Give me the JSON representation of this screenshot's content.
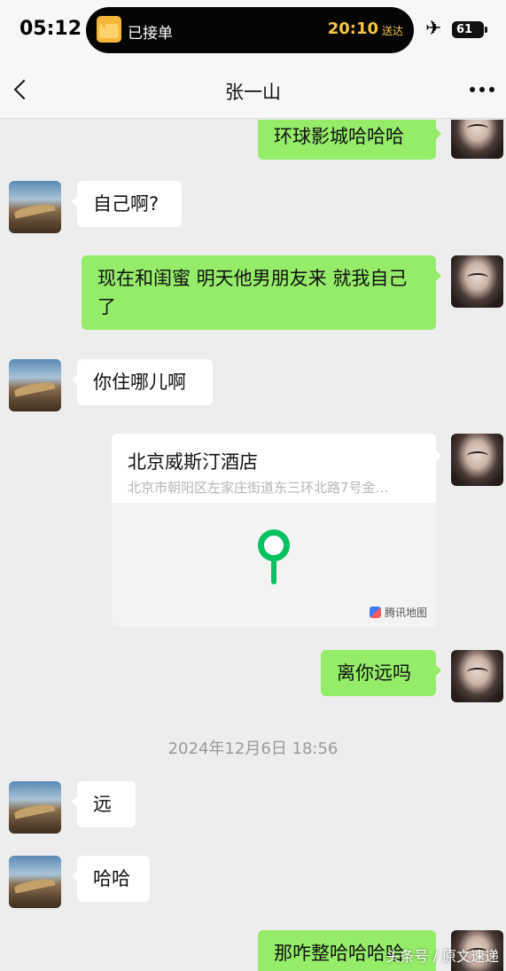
{
  "status_bar": {
    "time": "05:12",
    "activity_label": "已接单",
    "activity_eta": "20:10",
    "activity_eta_suffix": "送达",
    "airplane": "✈",
    "battery": "61"
  },
  "nav": {
    "title": "张一山"
  },
  "messages": [
    {
      "from": "me",
      "text": "环球影城哈哈哈"
    },
    {
      "from": "other",
      "text": "自己啊?"
    },
    {
      "from": "me",
      "text": "现在和闺蜜 明天他男朋友来 就我自己了"
    },
    {
      "from": "other",
      "text": "你住哪儿啊"
    },
    {
      "from": "me",
      "type": "location",
      "name": "北京威斯汀酒店",
      "address": "北京市朝阳区左家庄街道东三环北路7号金…",
      "map_brand": "腾讯地图"
    },
    {
      "from": "me",
      "text": "离你远吗"
    },
    {
      "type": "timestamp",
      "text": "2024年12月6日 18:56"
    },
    {
      "from": "other",
      "text": "远"
    },
    {
      "from": "other",
      "text": "哈哈"
    },
    {
      "from": "me",
      "text": "那咋整哈哈哈哈"
    }
  ],
  "watermark": "头条号 / 原文速递",
  "colors": {
    "my_bubble": "#95ec69",
    "other_bubble": "#ffffff",
    "pin": "#07c160",
    "island_accent": "#f7c542"
  }
}
